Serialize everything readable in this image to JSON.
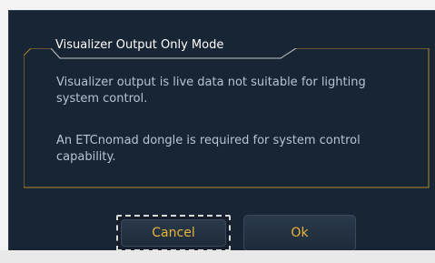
{
  "dialog": {
    "group_title": "Visualizer Output Only Mode",
    "message_1": "Visualizer output is live data not suitable for lighting system control.",
    "message_2": "An ETCnomad dongle is required for system control capability.",
    "buttons": {
      "cancel": "Cancel",
      "ok": "Ok"
    }
  },
  "colors": {
    "dialog_bg": "#182535",
    "frame": "#b08a2a",
    "button_text": "#e8b43a",
    "message_text": "#b7c4d0"
  }
}
